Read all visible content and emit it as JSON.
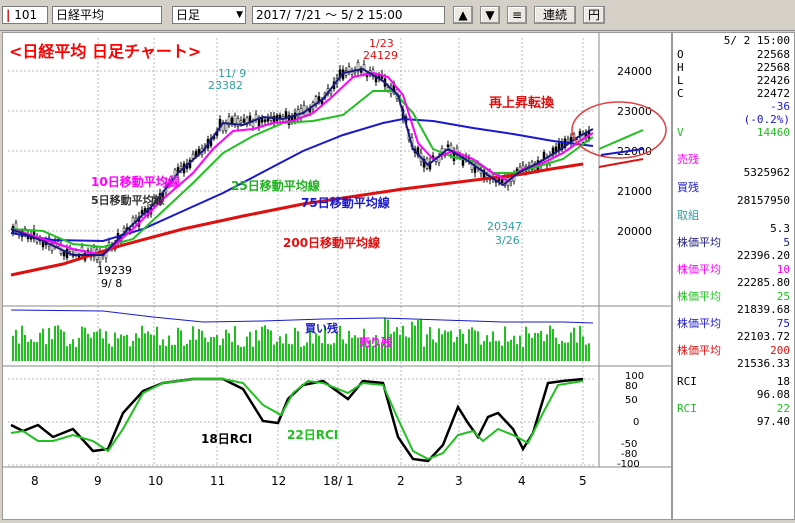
{
  "toolbar": {
    "code": "101",
    "name": "日経平均",
    "period_select": "日足",
    "date_range": "2017/ 7/21 ～  5/ 2 15:00",
    "buttons": [
      "▲",
      "▼",
      "≡",
      "連続",
      "円"
    ]
  },
  "chart_title": "<日経平均  日足チャート>",
  "price_axis": [
    "24000",
    "23000",
    "22000",
    "21000",
    "20000"
  ],
  "x_axis": [
    "8",
    "9",
    "10",
    "11",
    "12",
    "18/ 1",
    "2",
    "3",
    "4",
    "5"
  ],
  "annotations": {
    "high_date": "1/23",
    "high_value": "24129",
    "p1_date": "11/ 9",
    "p1_value": "23382",
    "low1_value": "19239",
    "low1_date": "9/ 8",
    "low2_value": "20347",
    "low2_date": "3/26",
    "breakout": "再上昇転換"
  },
  "ma_labels": {
    "ma10": "10日移動平均線",
    "ma5": "5日移動平均線",
    "ma25": "25日移動平均線",
    "ma75": "75日移動平均線",
    "ma200": "200日移動平均線"
  },
  "volume_labels": {
    "buy": "買い残",
    "sell": "売り残"
  },
  "rci_labels": {
    "rci18": "18日RCI",
    "rci22": "22日RCI"
  },
  "rci_axis": [
    "100",
    "80",
    "50",
    "0",
    "-50",
    "-80",
    "-100"
  ],
  "colors": {
    "title": "#ff0000",
    "candle": "#000000",
    "ma5": "#1a1a80",
    "ma10": "#ff00ff",
    "ma25": "#20c020",
    "ma75": "#1818d0",
    "ma200": "#e01010",
    "volume": "#20c020",
    "rci18": "#000000",
    "rci22": "#20c020",
    "label_teal": "#30a0a0",
    "circle": "#e04040"
  },
  "side_panel": {
    "datetime": "5/ 2 15:00",
    "ohlc": [
      {
        "k": "O",
        "v": "22568"
      },
      {
        "k": "H",
        "v": "22568"
      },
      {
        "k": "L",
        "v": "22426"
      },
      {
        "k": "C",
        "v": "22472"
      },
      {
        "k": "",
        "v": "-36"
      },
      {
        "k": "",
        "v": "(-0.2%)"
      },
      {
        "k": "V",
        "v": "14460"
      }
    ],
    "sell_zan_label": "売残",
    "sell_zan_value": "5325962",
    "buy_zan_label": "買残",
    "buy_zan_value": "28157950",
    "torikumi_label": "取組",
    "torikumi_value": "5.3",
    "ma": [
      {
        "label": "株価平均",
        "period": "5",
        "value": "22396.20",
        "color": "#1a1a80"
      },
      {
        "label": "株価平均",
        "period": "10",
        "value": "22285.80",
        "color": "#ff00ff"
      },
      {
        "label": "株価平均",
        "period": "25",
        "value": "21839.68",
        "color": "#20c020"
      },
      {
        "label": "株価平均",
        "period": "75",
        "value": "22103.72",
        "color": "#1818d0"
      },
      {
        "label": "株価平均",
        "period": "200",
        "value": "21536.33",
        "color": "#e01010"
      }
    ],
    "rci": [
      {
        "label": "RCI",
        "period": "18",
        "value": "96.08",
        "color": "#000000"
      },
      {
        "label": "RCI",
        "period": "22",
        "value": "97.40",
        "color": "#20c020"
      }
    ]
  }
}
